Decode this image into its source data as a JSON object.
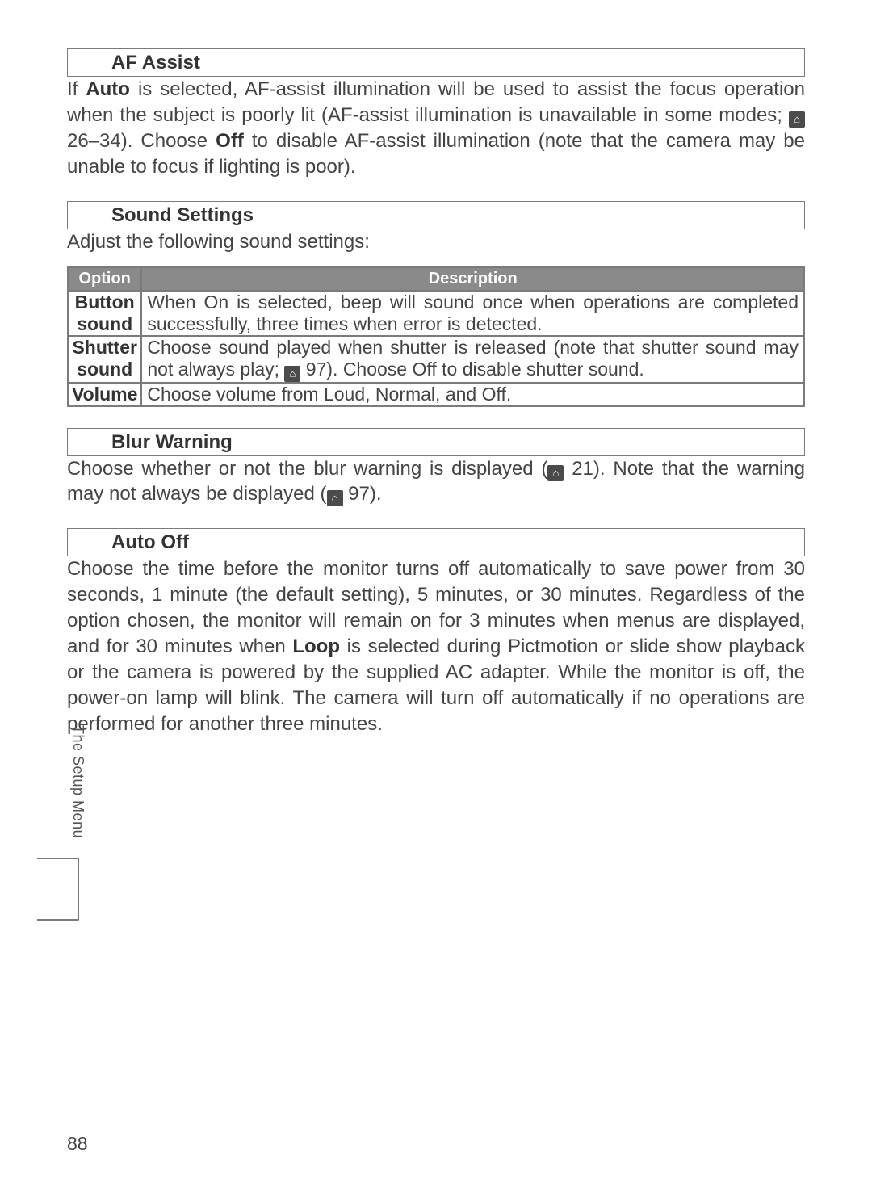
{
  "sections": {
    "afAssist": {
      "title": "AF Assist",
      "body_pre": "If ",
      "body_auto": "Auto",
      "body_mid1": " is selected, AF-assist illumination will be used to assist the focus operation when the subject is poorly lit (AF-assist illumination is unavailable in some modes; ",
      "ref1_icon": "⌂",
      "ref1": "26–34).  Choose ",
      "body_off": "Off",
      "body_post": " to disable AF-assist illumination (note that the camera may be unable to focus if lighting is poor)."
    },
    "sound": {
      "title": "Sound Settings",
      "intro": "Adjust the following sound settings:",
      "headers": {
        "option": "Option",
        "description": "Description"
      },
      "rows": [
        {
          "option": "Button sound",
          "desc_pre": "When ",
          "desc_on": "On",
          "desc_post": " is selected, beep will sound once when operations are completed successfully, three times when error is detected."
        },
        {
          "option": "Shutter sound",
          "desc_pre": "Choose sound played when shutter is released (note that shutter sound may not always play; ",
          "ref_icon": "⌂",
          "ref": "97).  Choose ",
          "desc_off": "Off",
          "desc_post": " to disable shutter sound."
        },
        {
          "option": "Volume",
          "desc_pre": "Choose volume from ",
          "v1": "Loud",
          "sep1": ", ",
          "v2": "Normal",
          "sep2": ", and ",
          "v3": "Off",
          "desc_post": "."
        }
      ]
    },
    "blur": {
      "title": "Blur Warning",
      "body_pre": "Choose whether or not the blur warning is displayed (",
      "ref1_icon": "⌂",
      "ref1": "21).  Note that the warning may not always be displayed (",
      "ref2_icon": "⌂",
      "ref2": "97)."
    },
    "autoOff": {
      "title": "Auto Off",
      "body_pre": "Choose the time before the monitor turns off automatically to save power from 30 seconds, 1 minute (the default setting), 5 minutes, or 30 minutes.  Regardless of the option chosen, the monitor will remain on for 3 minutes when menus are displayed, and for 30 minutes when ",
      "loop": "Loop",
      "body_post": " is selected during Pictmotion or slide show playback or the camera is powered by the supplied AC adapter.  While the monitor is off, the power-on lamp will blink.  The camera will turn off automatically if no operations are performed for another three minutes."
    }
  },
  "sideLabel": "The Setup Menu",
  "pageNumber": "88"
}
